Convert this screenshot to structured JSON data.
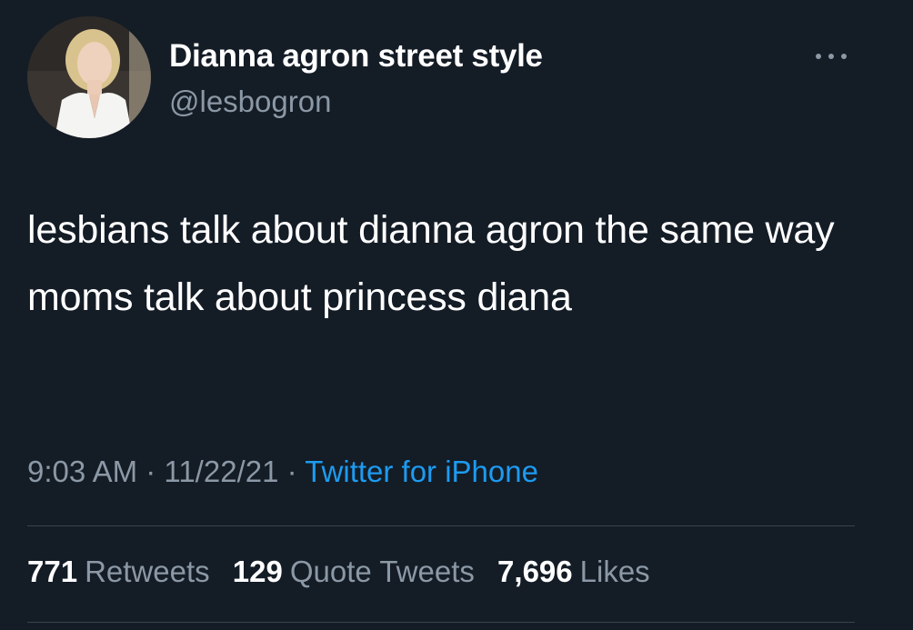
{
  "author": {
    "display_name": "Dianna agron street style",
    "handle": "@lesbogron"
  },
  "tweet": {
    "text": "lesbians talk about dianna agron the same way moms talk about princess diana",
    "time": "9:03 AM",
    "separator": "·",
    "date": "11/22/21",
    "source": "Twitter for iPhone"
  },
  "stats": {
    "retweets_count": "771",
    "retweets_label": "Retweets",
    "quotes_count": "129",
    "quotes_label": "Quote Tweets",
    "likes_count": "7,696",
    "likes_label": "Likes"
  },
  "colors": {
    "background": "#141c26",
    "primary_text": "#ffffff",
    "secondary_text": "#8b98a5",
    "link": "#1d9bf0",
    "divider": "#38444d"
  },
  "icons": {
    "more": "more-horizontal-icon"
  }
}
